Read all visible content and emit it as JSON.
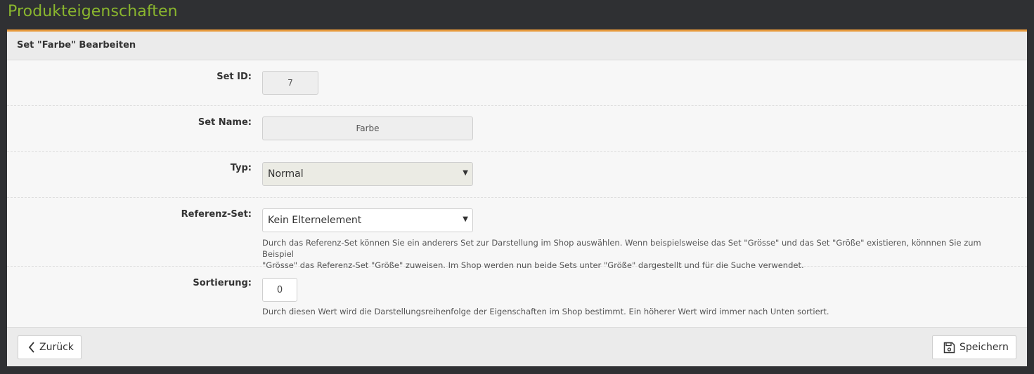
{
  "page": {
    "title": "Produkteigenschaften"
  },
  "panel": {
    "title": "Set \"Farbe\" Bearbeiten"
  },
  "form": {
    "set_id": {
      "label": "Set ID:",
      "value": "7"
    },
    "set_name": {
      "label": "Set Name:",
      "value": "Farbe"
    },
    "typ": {
      "label": "Typ:",
      "value": "Normal"
    },
    "referenz_set": {
      "label": "Referenz-Set:",
      "value": "Kein Elternelement",
      "help_line1": "Durch das Referenz-Set können Sie ein anderers Set zur Darstellung im Shop auswählen. Wenn beispielsweise das Set \"Grösse\" und das Set \"Größe\" existieren, könnnen Sie zum Beispiel",
      "help_line2": "\"Grösse\" das Referenz-Set \"Größe\" zuweisen. Im Shop werden nun beide Sets unter \"Größe\" dargestellt und für die Suche verwendet."
    },
    "sortierung": {
      "label": "Sortierung:",
      "value": "0",
      "help": "Durch diesen Wert wird die Darstellungsreihenfolge der Eigenschaften im Shop bestimmt. Ein höherer Wert wird immer nach Unten sortiert."
    }
  },
  "footer": {
    "back_label": "Zurück",
    "save_label": "Speichern"
  },
  "colors": {
    "title_green": "#8ab62e",
    "accent_orange": "#e89a3c",
    "background_dark": "#2f3033"
  },
  "icons": {
    "back": "chevron-left-icon",
    "save": "floppy-disk-icon",
    "caret": "caret-down-icon"
  }
}
